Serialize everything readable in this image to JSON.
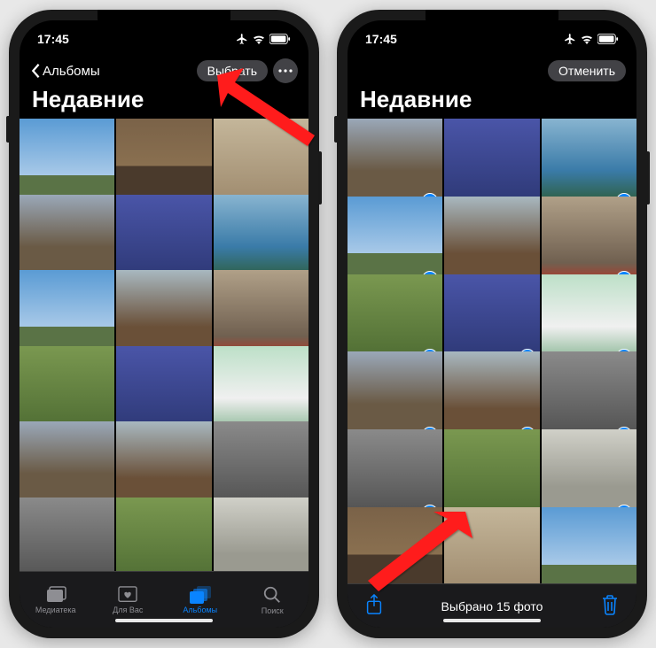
{
  "status": {
    "time": "17:45"
  },
  "left": {
    "back_label": "Альбомы",
    "select_label": "Выбрать",
    "title": "Недавние",
    "tabs": {
      "library": "Медиатека",
      "for_you": "Для Вас",
      "albums": "Альбомы",
      "search": "Поиск"
    },
    "thumbs": [
      {
        "cls": "sky",
        "heart": true
      },
      {
        "cls": "castle",
        "heart": false
      },
      {
        "cls": "church",
        "heart": false
      },
      {
        "cls": "ruins",
        "heart": true
      },
      {
        "cls": "building",
        "heart": false
      },
      {
        "cls": "lake",
        "heart": true
      },
      {
        "cls": "sky",
        "heart": true
      },
      {
        "cls": "rock",
        "heart": false
      },
      {
        "cls": "hill",
        "heart": true
      },
      {
        "cls": "green",
        "heart": true
      },
      {
        "cls": "building",
        "heart": false
      },
      {
        "cls": "waterfall",
        "heart": true
      },
      {
        "cls": "ruins",
        "heart": false
      },
      {
        "cls": "rock",
        "heart": false
      },
      {
        "cls": "road",
        "heart": true
      },
      {
        "cls": "road",
        "heart": false
      },
      {
        "cls": "green",
        "heart": false
      },
      {
        "cls": "tower",
        "heart": false
      }
    ]
  },
  "right": {
    "cancel_label": "Отменить",
    "title": "Недавние",
    "selected_text": "Выбрано 15 фото",
    "thumbs": [
      {
        "cls": "ruins",
        "heart": true,
        "sel": true
      },
      {
        "cls": "building",
        "heart": false,
        "sel": false
      },
      {
        "cls": "lake",
        "heart": true,
        "sel": true
      },
      {
        "cls": "sky",
        "heart": true,
        "sel": true
      },
      {
        "cls": "rock",
        "heart": false,
        "sel": false
      },
      {
        "cls": "hill",
        "heart": true,
        "sel": true
      },
      {
        "cls": "green",
        "heart": true,
        "sel": true
      },
      {
        "cls": "building",
        "heart": false,
        "sel": true
      },
      {
        "cls": "waterfall",
        "heart": true,
        "sel": true
      },
      {
        "cls": "ruins",
        "heart": false,
        "sel": true
      },
      {
        "cls": "rock",
        "heart": false,
        "sel": true
      },
      {
        "cls": "road",
        "heart": true,
        "sel": true
      },
      {
        "cls": "road",
        "heart": false,
        "sel": true
      },
      {
        "cls": "green",
        "heart": false,
        "sel": false
      },
      {
        "cls": "tower",
        "heart": false,
        "sel": true
      },
      {
        "cls": "castle",
        "heart": false,
        "sel": false
      },
      {
        "cls": "church",
        "heart": false,
        "sel": false
      },
      {
        "cls": "sky",
        "heart": false,
        "sel": false
      }
    ]
  }
}
